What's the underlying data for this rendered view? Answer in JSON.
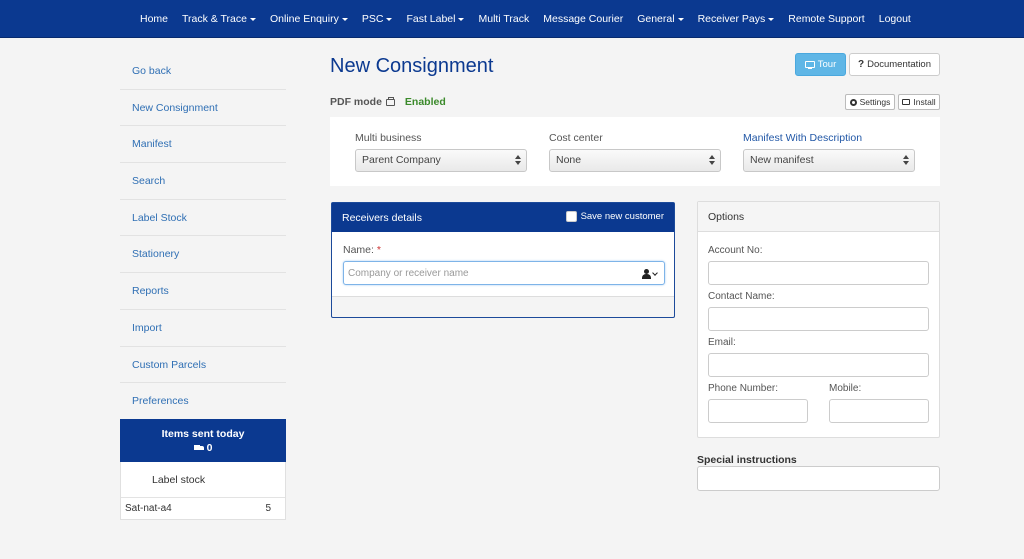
{
  "nav": {
    "items": [
      {
        "label": "Home",
        "dropdown": false
      },
      {
        "label": "Track & Trace",
        "dropdown": true
      },
      {
        "label": "Online Enquiry",
        "dropdown": true
      },
      {
        "label": "PSC",
        "dropdown": true
      },
      {
        "label": "Fast Label",
        "dropdown": true
      },
      {
        "label": "Multi Track",
        "dropdown": false
      },
      {
        "label": "Message Courier",
        "dropdown": false
      },
      {
        "label": "General",
        "dropdown": true
      },
      {
        "label": "Receiver Pays",
        "dropdown": true
      },
      {
        "label": "Remote Support",
        "dropdown": false
      },
      {
        "label": "Logout",
        "dropdown": false
      }
    ]
  },
  "sidebar": {
    "links": [
      "Go back",
      "New Consignment",
      "Manifest",
      "Search",
      "Label Stock",
      "Stationery",
      "Reports",
      "Import",
      "Custom Parcels",
      "Preferences"
    ],
    "items_today_title": "Items sent today",
    "items_today_count": "0",
    "label_stock_title": "Label stock",
    "label_stock_rows": [
      {
        "name": "Sat-nat-a4",
        "qty": "5"
      }
    ]
  },
  "header": {
    "title": "New Consignment",
    "tour_label": "Tour",
    "documentation_label": "Documentation"
  },
  "pdf": {
    "label": "PDF mode",
    "status": "Enabled",
    "settings_label": "Settings",
    "install_label": "Install"
  },
  "business": {
    "multi_business_label": "Multi business",
    "multi_business_value": "Parent Company",
    "cost_center_label": "Cost center",
    "cost_center_value": "None",
    "manifest_label": "Manifest With Description",
    "manifest_value": "New manifest"
  },
  "receivers": {
    "title": "Receivers details",
    "save_new_customer": "Save new customer",
    "name_label": "Name:",
    "required_mark": "*",
    "name_placeholder": "Company or receiver name"
  },
  "options": {
    "title": "Options",
    "account_label": "Account No:",
    "contact_label": "Contact Name:",
    "email_label": "Email:",
    "phone_label": "Phone Number:",
    "mobile_label": "Mobile:"
  },
  "special": {
    "label": "Special instructions"
  },
  "colors": {
    "brand_navy": "#0b3990",
    "link_blue": "#2f6fb4",
    "tour_blue": "#5fb6e6",
    "enabled_green": "#3b8a2b"
  }
}
